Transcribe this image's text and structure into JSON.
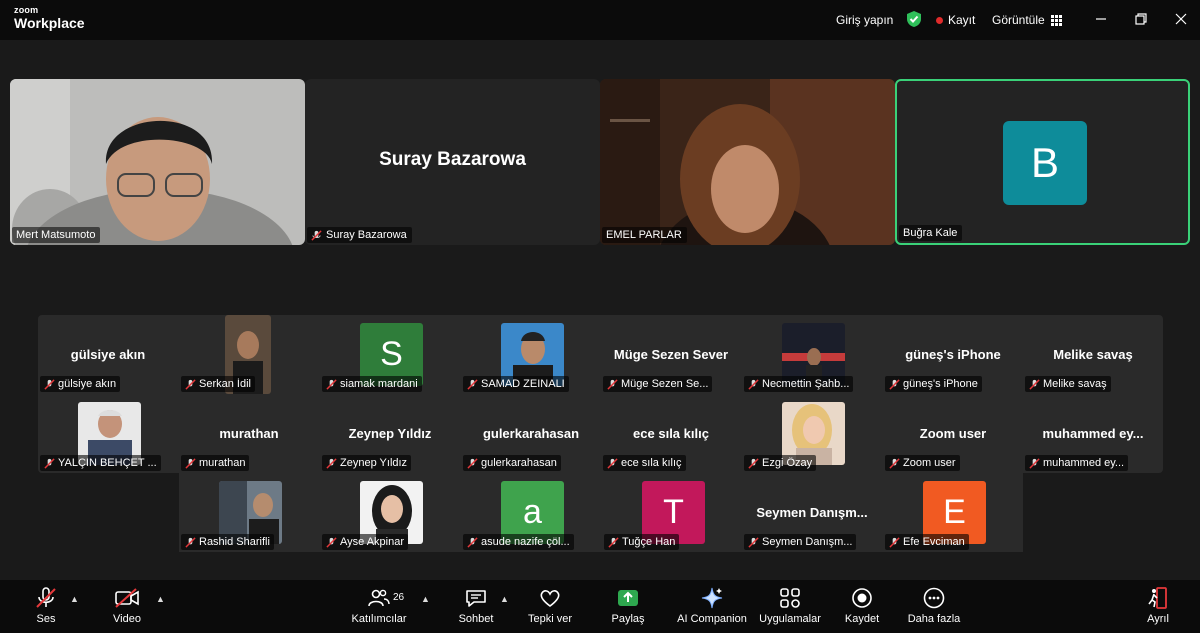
{
  "titlebar": {
    "logo_line1": "zoom",
    "logo_line2": "Workplace",
    "signin": "Giriş yapın",
    "record": "Kayıt",
    "view": "Görüntüle"
  },
  "tiles": [
    {
      "name": "Mert Matsumoto"
    },
    {
      "name": "Suray Bazarowa",
      "center_name": "Suray Bazarowa"
    },
    {
      "name": "EMEL PARLAR"
    },
    {
      "name": "Buğra Kale",
      "avatar_letter": "B"
    }
  ],
  "gallery": [
    {
      "tag": "gülsiye akın",
      "center": "gülsiye akın"
    },
    {
      "tag": "Serkan İdil"
    },
    {
      "tag": "siamak mardani",
      "letter": "S"
    },
    {
      "tag": "SAMAD ZEINALI"
    },
    {
      "tag": "Müge Sezen Se...",
      "center": "Müge Sezen Sever"
    },
    {
      "tag": "Necmettin Şahb..."
    },
    {
      "tag": "güneş's iPhone",
      "center": "güneş's iPhone"
    },
    {
      "tag": "Melike savaş",
      "center": "Melike savaş"
    },
    {
      "tag": "YALÇIN BEHÇET ..."
    },
    {
      "tag": "murathan",
      "center": "murathan"
    },
    {
      "tag": "Zeynep Yıldız",
      "center": "Zeynep Yıldız"
    },
    {
      "tag": "gulerkarahasan",
      "center": "gulerkarahasan"
    },
    {
      "tag": "ece sıla kılıç",
      "center": "ece sıla kılıç"
    },
    {
      "tag": "Ezgi Özay"
    },
    {
      "tag": "Zoom user",
      "center": "Zoom user"
    },
    {
      "tag": "muhammed ey...",
      "center": "muhammed ey..."
    },
    {
      "tag": "Rashid Sharifli"
    },
    {
      "tag": "Ayse Akpinar"
    },
    {
      "tag": "asude nazife çöl...",
      "letter": "a"
    },
    {
      "tag": "Tuğçe Han",
      "letter": "T"
    },
    {
      "tag": "Seymen Danışm...",
      "center": "Seymen Danışm..."
    },
    {
      "tag": "Efe Evciman",
      "letter": "E"
    }
  ],
  "toolbar": {
    "audio": "Ses",
    "video": "Video",
    "participants": "Katılımcılar",
    "participants_count": "26",
    "chat": "Sohbet",
    "react": "Tepki ver",
    "share": "Paylaş",
    "ai": "AI Companion",
    "apps": "Uygulamalar",
    "record": "Kaydet",
    "more": "Daha fazla",
    "leave": "Ayrıl"
  },
  "colors": {
    "active_border": "#3ad178",
    "share_green": "#2ea84f",
    "avatar_teal": "#0e8c9a",
    "avatar_green": "#2f7d3a",
    "avatar_magenta": "#c2185b",
    "avatar_orange": "#f15a22",
    "leave_red": "#e5383b"
  }
}
